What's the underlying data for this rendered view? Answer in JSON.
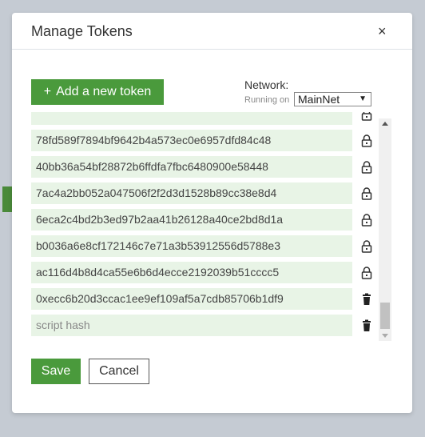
{
  "modal": {
    "title": "Manage Tokens",
    "close_label": "×"
  },
  "add_button": {
    "icon": "+",
    "label": "Add a new token"
  },
  "network": {
    "label": "Network:",
    "running_on": "Running on",
    "selected": "MainNet"
  },
  "tokens": [
    {
      "value": "",
      "icon": "lock-icon"
    },
    {
      "value": "78fd589f7894bf9642b4a573ec0e6957dfd84c48",
      "icon": "lock-icon"
    },
    {
      "value": "40bb36a54bf28872b6ffdfa7fbc6480900e58448",
      "icon": "lock-icon"
    },
    {
      "value": "7ac4a2bb052a047506f2f2d3d1528b89cc38e8d4",
      "icon": "lock-icon"
    },
    {
      "value": "6eca2c4bd2b3ed97b2aa41b26128a40ce2bd8d1a",
      "icon": "lock-icon"
    },
    {
      "value": "b0036a6e8cf172146c7e71a3b53912556d5788e3",
      "icon": "lock-icon"
    },
    {
      "value": "ac116d4b8d4ca55e6b6d4ecce2192039b51cccc5",
      "icon": "lock-icon"
    },
    {
      "value": "0xecc6b20d3ccac1ee9ef109af5a7cdb85706b1df9",
      "icon": "trash-icon"
    },
    {
      "value": "",
      "placeholder": "script hash",
      "icon": "trash-icon"
    }
  ],
  "footer": {
    "save_label": "Save",
    "cancel_label": "Cancel"
  },
  "colors": {
    "accent": "#4a9a3c",
    "row_bg": "#e8f4e6",
    "backdrop": "#c5cbd3"
  }
}
